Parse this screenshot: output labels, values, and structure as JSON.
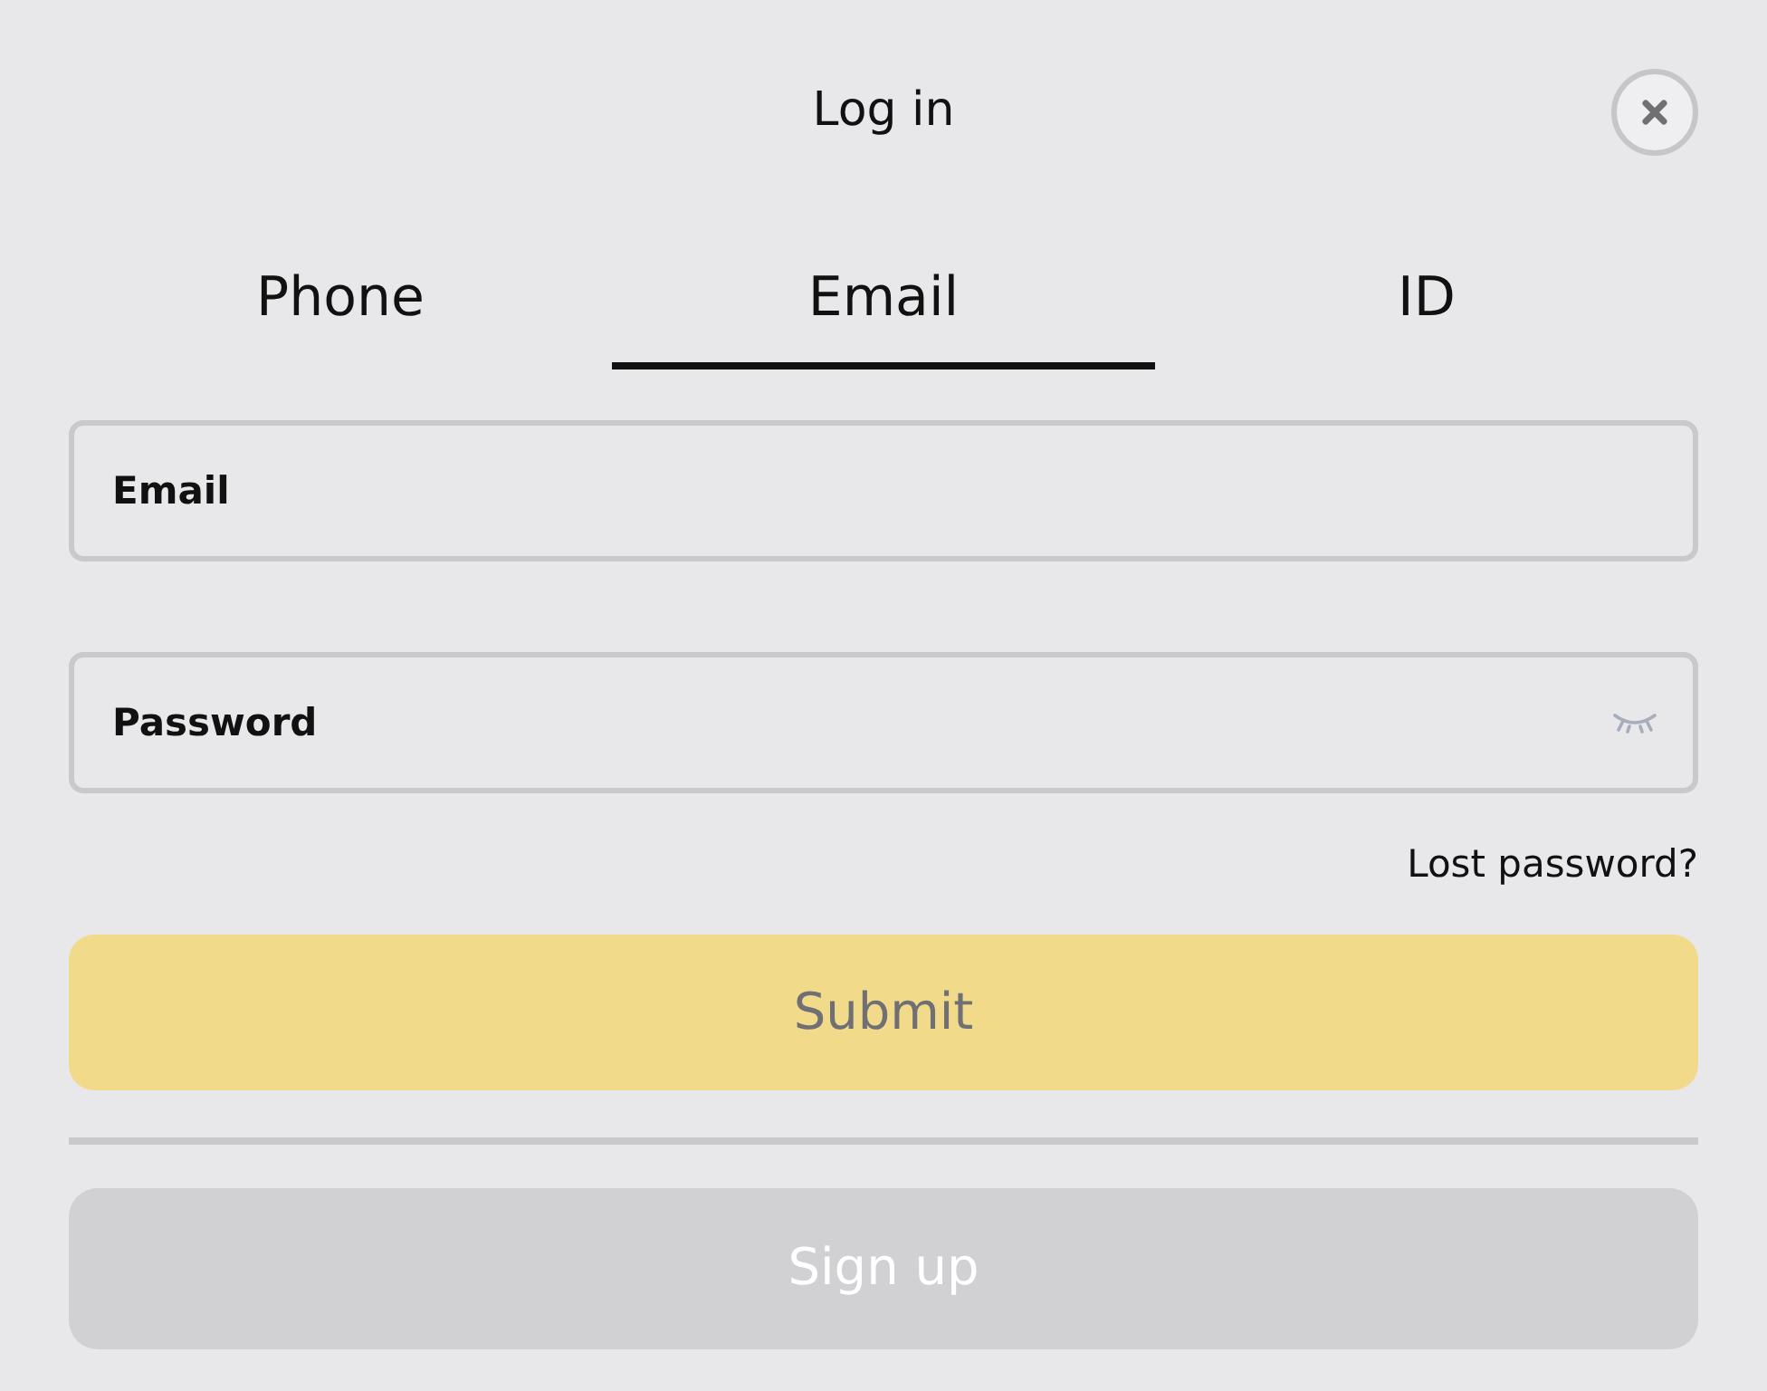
{
  "dialog": {
    "title": "Log in"
  },
  "tabs": [
    {
      "label": "Phone",
      "selected": false
    },
    {
      "label": "Email",
      "selected": true
    },
    {
      "label": "ID",
      "selected": false
    }
  ],
  "fields": [
    {
      "placeholder": "Email",
      "kind": "text"
    },
    {
      "placeholder": "Password",
      "kind": "password"
    }
  ],
  "lost_password_link": "Lost password?",
  "submit_button": {
    "label": "Submit",
    "disabled": true
  },
  "signup_button": {
    "label": "Sign up"
  }
}
